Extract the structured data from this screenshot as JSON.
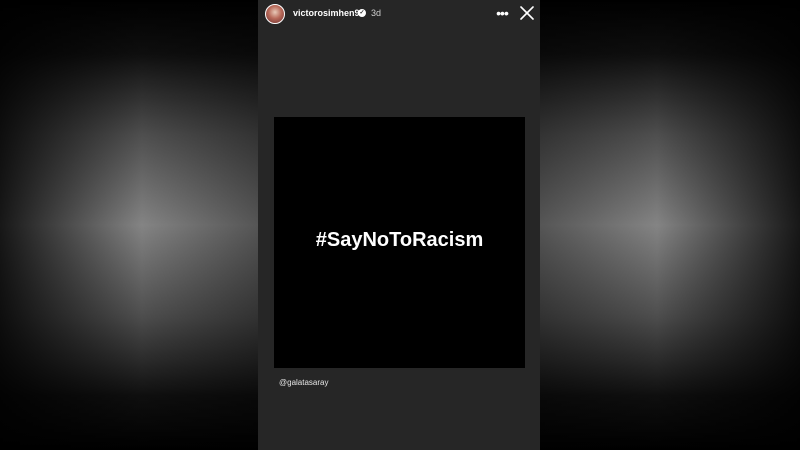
{
  "header": {
    "username": "victorosimhen9",
    "time_ago": "3d",
    "verified_icon": "verified-check-icon",
    "more_icon": "more-horizontal-icon",
    "close_icon": "close-icon"
  },
  "post": {
    "hashtag": "#SayNoToRacism",
    "mention": "@galatasaray"
  },
  "colors": {
    "story_bg": "#262626",
    "post_bg": "#000000",
    "text": "#ffffff"
  }
}
